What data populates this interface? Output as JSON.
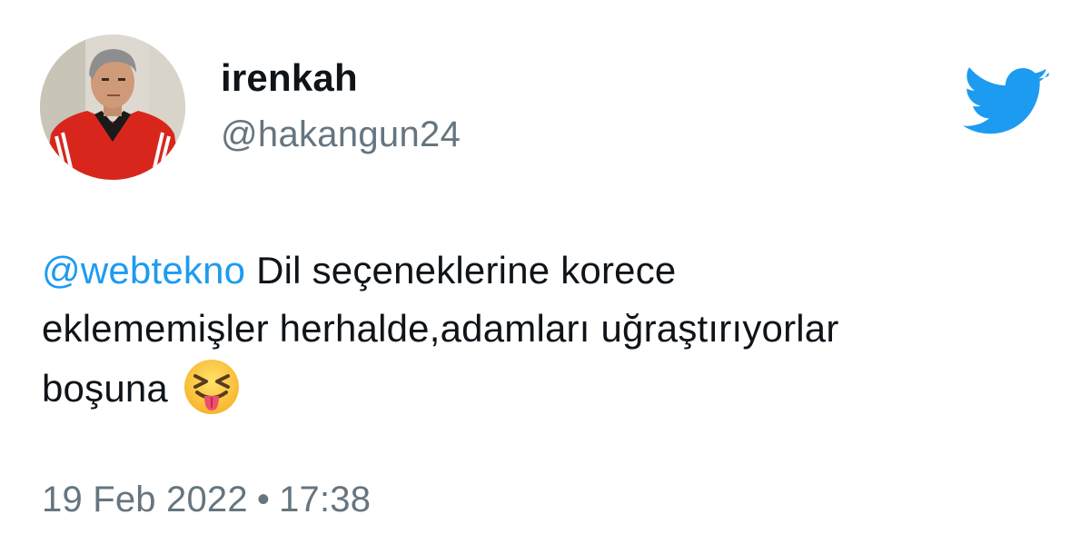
{
  "user": {
    "display_name": "irenkah",
    "handle": "@hakangun24"
  },
  "tweet": {
    "mention": "@webtekno",
    "text_line1_rest": " Dil seçeneklerine korece",
    "text_line2": "eklememişler herhalde,adamları uğraştırıyorlar",
    "text_line3": "boşuna",
    "emoji": "squinting-face-with-tongue"
  },
  "meta": {
    "date": "19 Feb 2022",
    "separator": "•",
    "time": "17:38"
  },
  "icons": {
    "brand": "twitter-bird-icon",
    "brand_color": "#1d9bf0",
    "mention_color": "#1d9bf0"
  }
}
